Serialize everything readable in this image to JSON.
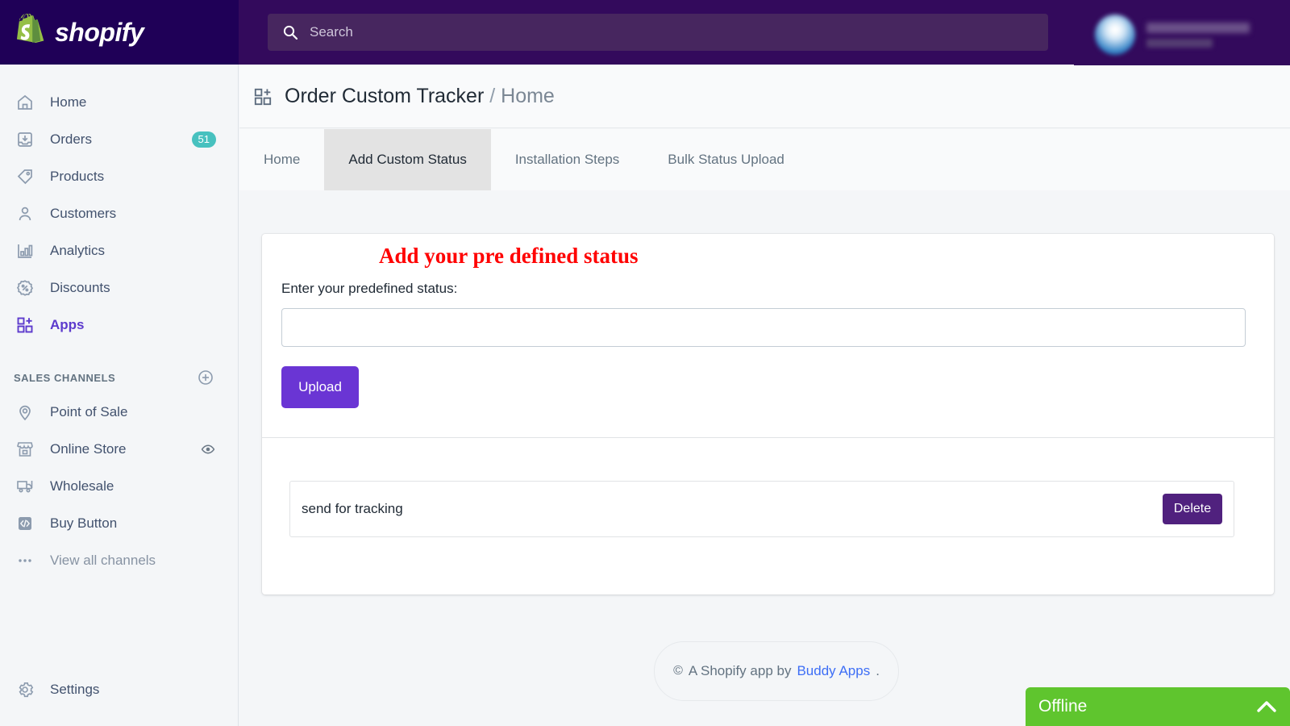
{
  "topbar": {
    "brand": "shopify",
    "brand_icon": "shopify-bag-logo",
    "search": {
      "icon": "search-icon",
      "placeholder": "Search",
      "value": ""
    },
    "user": {
      "avatar_icon": "user-avatar",
      "name_redacted": "",
      "store_redacted": ""
    }
  },
  "sidebar": {
    "items": [
      {
        "label": "Home",
        "icon": "home-icon",
        "badge": "",
        "active": false
      },
      {
        "label": "Orders",
        "icon": "orders-inbox-icon",
        "badge": "51",
        "active": false
      },
      {
        "label": "Products",
        "icon": "products-tag-icon",
        "badge": "",
        "active": false
      },
      {
        "label": "Customers",
        "icon": "customers-person-icon",
        "badge": "",
        "active": false
      },
      {
        "label": "Analytics",
        "icon": "analytics-bar-chart-icon",
        "badge": "",
        "active": false
      },
      {
        "label": "Discounts",
        "icon": "discounts-percent-icon",
        "badge": "",
        "active": false
      },
      {
        "label": "Apps",
        "icon": "apps-grid-plus-icon",
        "badge": "",
        "active": true
      }
    ],
    "section": {
      "title": "SALES CHANNELS",
      "add_icon": "plus-circle-icon"
    },
    "channels": [
      {
        "label": "Point of Sale",
        "icon": "location-pin-icon",
        "right_icon": ""
      },
      {
        "label": "Online Store",
        "icon": "storefront-icon",
        "right_icon": "eye-icon"
      },
      {
        "label": "Wholesale",
        "icon": "wholesale-truck-icon",
        "right_icon": ""
      },
      {
        "label": "Buy Button",
        "icon": "code-brackets-icon",
        "right_icon": ""
      },
      {
        "label": "View all channels",
        "icon": "ellipsis-icon",
        "right_icon": ""
      }
    ],
    "settings": {
      "label": "Settings",
      "icon": "gear-icon"
    }
  },
  "page": {
    "icon": "apps-grid-plus-icon",
    "app_name": "Order Custom Tracker",
    "separator": "/",
    "breadcrumb": "Home"
  },
  "tabs": [
    {
      "label": "Home",
      "active": false
    },
    {
      "label": "Add Custom Status",
      "active": true
    },
    {
      "label": "Installation Steps",
      "active": false
    },
    {
      "label": "Bulk Status Upload",
      "active": false
    }
  ],
  "form": {
    "heading": "Add your pre defined status",
    "field_label": "Enter your predefined status:",
    "input_value": "",
    "input_placeholder": "",
    "upload_label": "Upload"
  },
  "status_list": [
    {
      "name": "send for tracking",
      "delete_label": "Delete"
    }
  ],
  "footer": {
    "copyright_symbol": "©",
    "text": "A Shopify app by",
    "link": "Buddy Apps",
    "period": "."
  },
  "chat": {
    "label": "Offline",
    "chevron_icon": "chevron-up-icon"
  },
  "colors": {
    "topbar_left": "#1F0057",
    "topbar_right": "#330A5C",
    "search_field": "#47265F",
    "sidebar_bg": "#F4F6F8",
    "badge_teal": "#47C1BF",
    "apps_active": "#5C3ACD",
    "heading_red": "#FF0000",
    "upload_purple": "#6A35D4",
    "delete_purple": "#50217E",
    "link_blue": "#3D6EF6",
    "chat_green": "#5FC52E",
    "active_tab_bg": "#E3E3E3"
  }
}
